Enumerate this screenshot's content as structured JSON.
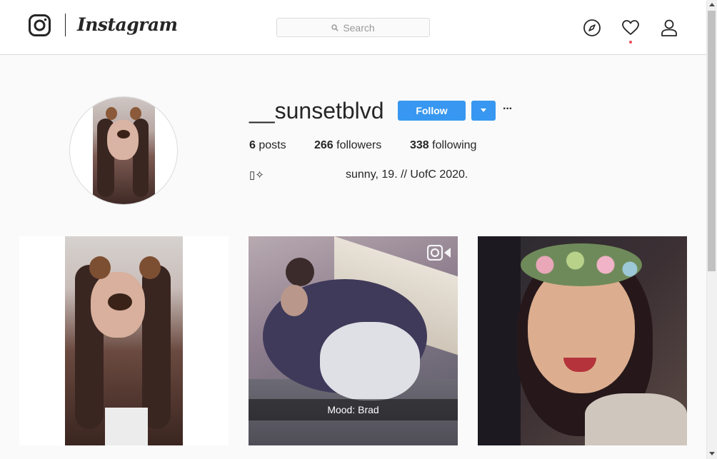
{
  "nav": {
    "logo_text": "Instagram",
    "search_placeholder": "Search",
    "icons": [
      "instagram-glyph-icon",
      "search-icon",
      "compass-icon",
      "heart-icon",
      "person-icon"
    ],
    "notification_dot_color": "#ed4956"
  },
  "profile": {
    "username": "__sunsetblvd",
    "follow_label": "Follow",
    "more_label": "···",
    "stats": [
      {
        "count": "6",
        "label": "posts"
      },
      {
        "count": "266",
        "label": "followers"
      },
      {
        "count": "338",
        "label": "following"
      }
    ],
    "bio_emoji": "▯✧",
    "bio_text": "sunny, 19. // UofC 2020."
  },
  "posts": [
    {
      "alt": "selfie with dog filter",
      "type": "photo"
    },
    {
      "alt": "friends on bed",
      "type": "video",
      "caption": "Mood: Brad"
    },
    {
      "alt": "selfie with flower crown filter",
      "type": "photo"
    }
  ],
  "colors": {
    "accent": "#3897f0",
    "text": "#262626",
    "border": "#dbdbdb",
    "background": "#fafafa"
  }
}
